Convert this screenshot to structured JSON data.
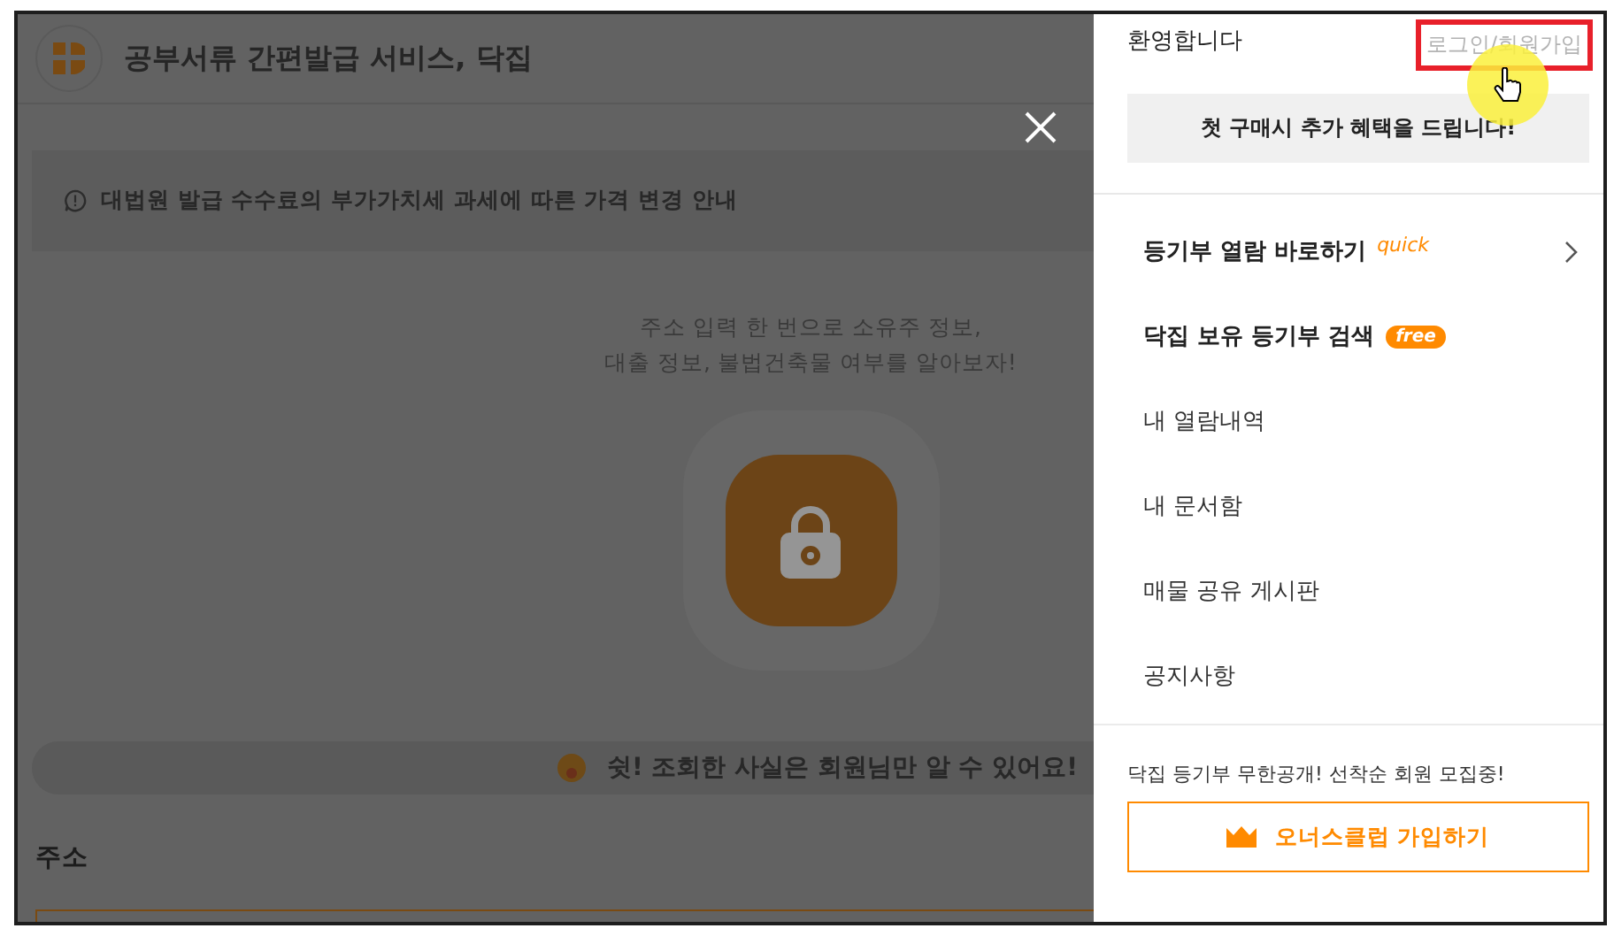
{
  "header": {
    "title": "공부서류 간편발급 서비스, 닥집"
  },
  "notice": {
    "text": "대법원 발급 수수료의 부가가치세 과세에 따른 가격 변경 안내"
  },
  "intro": {
    "lines": [
      "주소 입력 한 번으로 소유주 정보,",
      "대출 정보, 불법건축물 여부를 알아보자!"
    ]
  },
  "privacy_banner": {
    "text": "쉿! 조회한 사실은 회원님만 알 수 있어요!"
  },
  "address": {
    "label": "주소"
  },
  "drawer": {
    "greeting": "환영합니다",
    "login_link": {
      "text": "로그인/회원가입",
      "highlighted": true
    },
    "promo_button": "첫 구매시 추가 혜택을 드립니다!",
    "menu": [
      {
        "label": "등기부 열람 바로하기",
        "kind": "featured",
        "badge": {
          "kind": "quick",
          "text": "quick"
        },
        "chevron": true
      },
      {
        "label": "닥집 보유 등기부 검색",
        "kind": "featured",
        "badge": {
          "kind": "free",
          "text": "free"
        },
        "chevron": false
      },
      {
        "label": "내 열람내역",
        "kind": "plain",
        "chevron": false
      },
      {
        "label": "내 문서함",
        "kind": "plain",
        "chevron": false
      },
      {
        "label": "매물 공유 게시판",
        "kind": "plain",
        "chevron": false
      },
      {
        "label": "공지사항",
        "kind": "plain",
        "chevron": false
      }
    ],
    "footer_note": "닥집 등기부 무한공개! 선착순 회원 모집중!",
    "join_button": "오너스클럽 가입하기"
  }
}
